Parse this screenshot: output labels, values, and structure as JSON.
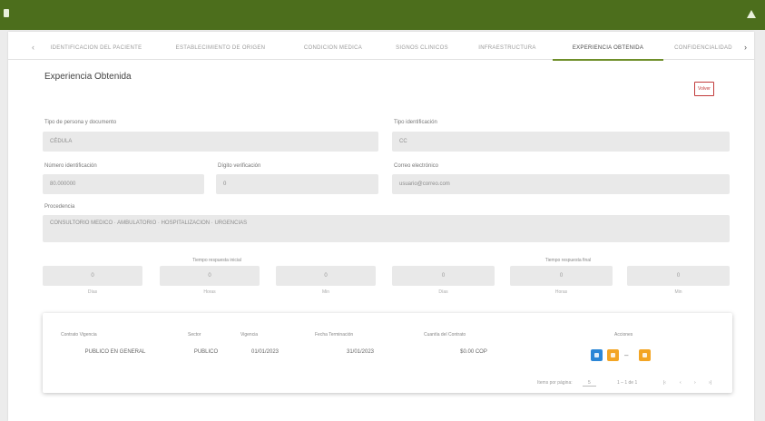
{
  "window": {
    "left_icon": "menu-icon",
    "right_icon": "warning-icon"
  },
  "tabs": {
    "items": [
      {
        "label": "IDENTIFICACION DEL PACIENTE"
      },
      {
        "label": "ESTABLECIMIENTO DE ORIGEN"
      },
      {
        "label": "CONDICION MEDICA"
      },
      {
        "label": "SIGNOS CLINICOS"
      },
      {
        "label": "INFRAESTRUCTURA"
      },
      {
        "label": "EXPERIENCIA OBTENIDA"
      },
      {
        "label": "CONFIDENCIALIDAD"
      }
    ],
    "active_index": 5,
    "prev_icon": "chevron-left-icon",
    "next_icon": "chevron-right-icon"
  },
  "page": {
    "title": "Experiencia Obtenida",
    "back_label": "Volver"
  },
  "form": {
    "nombre_label": "Tipo de persona y documento",
    "nombre_value": "CÉDULA",
    "tipo_id_label": "Tipo identificación",
    "tipo_id_value": "CC",
    "numero_id_label": "Número identificación",
    "numero_id_value": "80.000000",
    "digito_label": "Dígito verificación",
    "digito_value": "0",
    "correo_label": "Correo electrónico",
    "correo_value": "usuario@correo.com",
    "procedencia_label": "Procedencia",
    "procedencia_value": "CONSULTORIO MEDICO · AMBULATORIO · HOSPITALIZACION · URGENCIAS"
  },
  "schedule": {
    "group_start_label": "Tiempo respuesta inicial",
    "group_end_label": "Tiempo respuesta final",
    "boxes": [
      {
        "value": "0",
        "sub": "Días"
      },
      {
        "value": "0",
        "sub": "Horas"
      },
      {
        "value": "0",
        "sub": "Min"
      },
      {
        "value": "0",
        "sub": "Días"
      },
      {
        "value": "0",
        "sub": "Horas"
      },
      {
        "value": "0",
        "sub": "Min"
      }
    ]
  },
  "table": {
    "headers": [
      "Contrato Vigencia",
      "Sector",
      "Vigencia",
      "Fecha Terminación",
      "Cuantía del Contrato",
      "Acciones"
    ],
    "row": [
      "PUBLICO EN GENERAL",
      "PUBLICO",
      "01/01/2023",
      "31/01/2023",
      "$0.00 COP",
      ""
    ],
    "action_icons": [
      "edit-icon",
      "view-icon",
      "delete-icon"
    ],
    "pager": {
      "rows_label": "Items por página:",
      "rows_value": "5",
      "range": "1 – 1 de 1",
      "first_icon": "first-page-icon",
      "prev_icon": "prev-page-icon",
      "next_icon": "next-page-icon",
      "last_icon": "last-page-icon"
    }
  }
}
